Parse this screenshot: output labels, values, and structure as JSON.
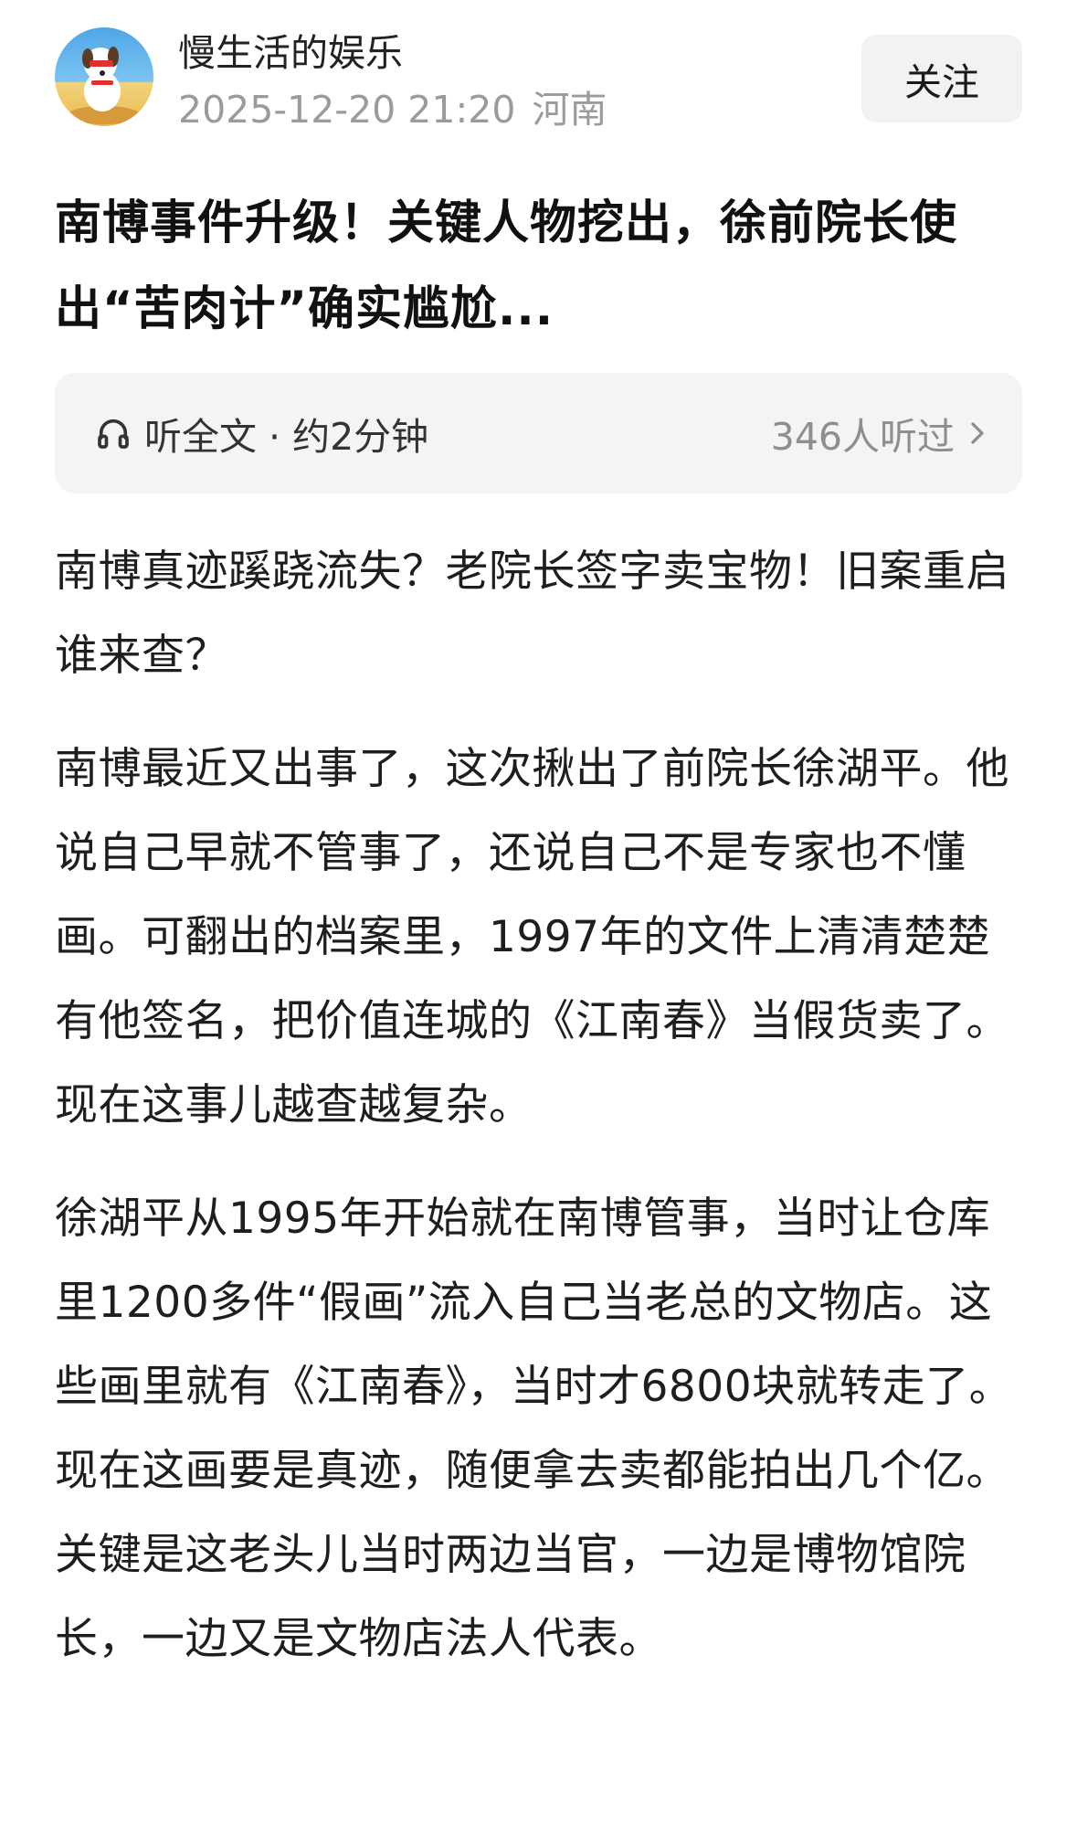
{
  "author": {
    "name": "慢生活的娱乐",
    "date": "2025-12-20 21:20",
    "location": "河南",
    "follow_label": "关注"
  },
  "article": {
    "title": "南博事件升级！关键人物挖出，徐前院长使出“苦肉计”确实尴尬...",
    "listen": {
      "label": "听全文 · 约2分钟",
      "count": "346人听过",
      "icon": "headphones-icon"
    },
    "paragraphs": [
      "南博真迹蹊跷流失？老院长签字卖宝物！旧案重启谁来查？",
      "南博最近又出事了，这次揪出了前院长徐湖平。他说自己早就不管事了，还说自己不是专家也不懂画。可翻出的档案里，1997年的文件上清清楚楚有他签名，把价值连城的《江南春》当假货卖了。现在这事儿越查越复杂。",
      "徐湖平从1995年开始就在南博管事，当时让仓库里1200多件“假画”流入自己当老总的文物店。这些画里就有《江南春》，当时才6800块就转走了。现在这画要是真迹，随便拿去卖都能拍出几个亿。关键是这老头儿当时两边当官，一边是博物馆院长，一边又是文物店法人代表。"
    ]
  }
}
